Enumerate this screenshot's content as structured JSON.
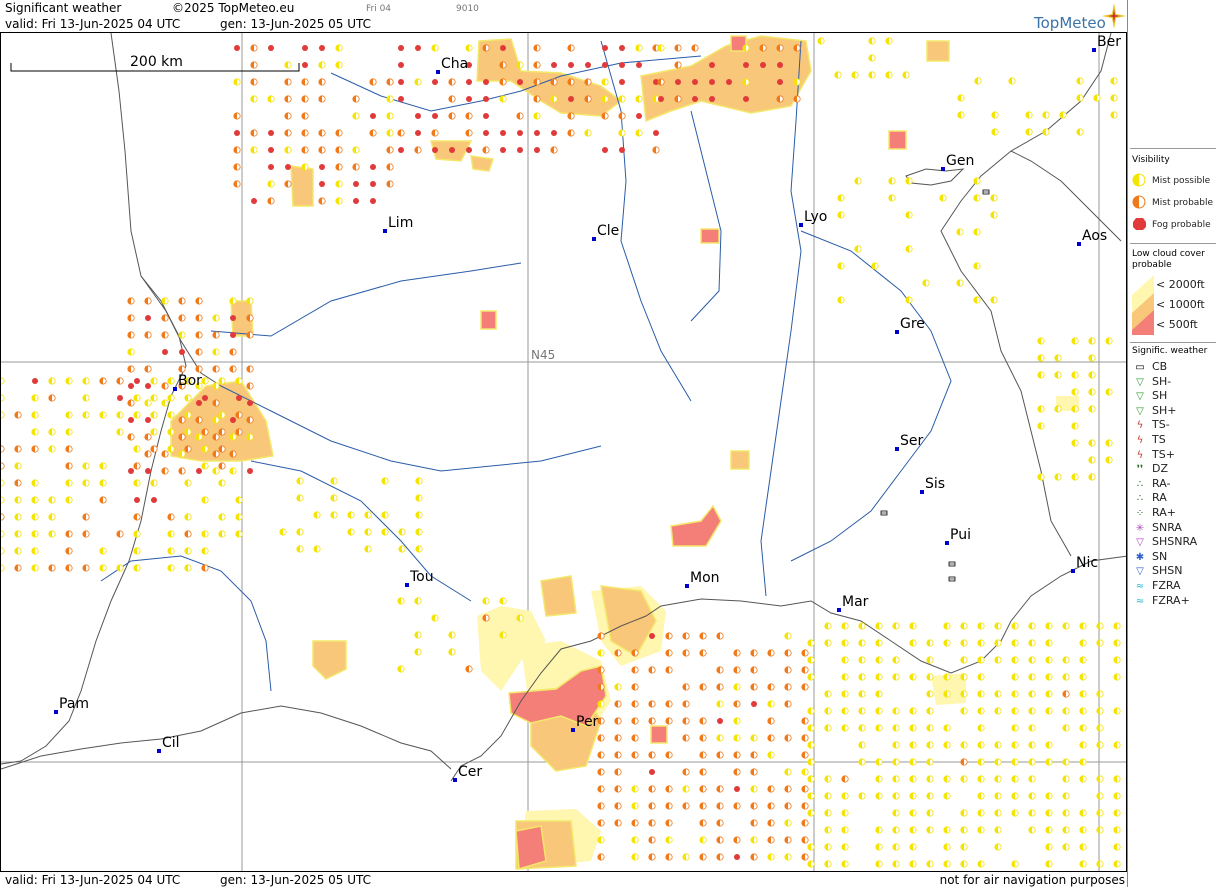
{
  "header": {
    "title": "Significant weather",
    "copyright": "©2025 TopMeteo.eu",
    "valid": "valid:  Fri  13-Jun-2025  04 UTC",
    "gen": "gen: 13-Jun-2025 05 UTC",
    "mini_label": "Fri 04",
    "mini_code": "9010",
    "logo": "TopMeteo"
  },
  "footer": {
    "valid": "valid:  Fri  13-Jun-2025  04 UTC",
    "gen": "gen: 13-Jun-2025 05 UTC",
    "disclaimer": "not for air navigation purposes"
  },
  "map": {
    "scale_label": "200 km",
    "lat_label": "N45",
    "cities": [
      {
        "name": "Cha"
      },
      {
        "name": "Ber"
      },
      {
        "name": "Gen"
      },
      {
        "name": "Lim"
      },
      {
        "name": "Cle"
      },
      {
        "name": "Lyo"
      },
      {
        "name": "Aos"
      },
      {
        "name": "Gre"
      },
      {
        "name": "Bor"
      },
      {
        "name": "Ser"
      },
      {
        "name": "Sis"
      },
      {
        "name": "Pui"
      },
      {
        "name": "Tou"
      },
      {
        "name": "Mon"
      },
      {
        "name": "Nic"
      },
      {
        "name": "Mar"
      },
      {
        "name": "Pam"
      },
      {
        "name": "Per"
      },
      {
        "name": "Cil"
      },
      {
        "name": "Cer"
      }
    ]
  },
  "legend": {
    "visibility_title": "Visibility",
    "visibility": [
      {
        "label": "Mist possible",
        "color": "#f5e300"
      },
      {
        "label": "Mist probable",
        "color": "#f07a1a"
      },
      {
        "label": "Fog probable",
        "color": "#e03a3a"
      }
    ],
    "cloud_title": "Low cloud cover probable",
    "cloud": [
      {
        "label": "< 2000ft",
        "color": "#fff6b0"
      },
      {
        "label": "< 1000ft",
        "color": "#f9c77a"
      },
      {
        "label": "<   500ft",
        "color": "#f47f78"
      }
    ],
    "sigwx_title": "Signific. weather",
    "sigwx": [
      {
        "label": "CB",
        "icon": "cb-icon"
      },
      {
        "label": "SH-",
        "icon": "shower-light-icon"
      },
      {
        "label": "SH",
        "icon": "shower-icon"
      },
      {
        "label": "SH+",
        "icon": "shower-heavy-icon"
      },
      {
        "label": "TS-",
        "icon": "thunderstorm-light-icon"
      },
      {
        "label": "TS",
        "icon": "thunderstorm-icon"
      },
      {
        "label": "TS+",
        "icon": "thunderstorm-heavy-icon"
      },
      {
        "label": "DZ",
        "icon": "drizzle-icon"
      },
      {
        "label": "RA-",
        "icon": "rain-light-icon"
      },
      {
        "label": "RA",
        "icon": "rain-icon"
      },
      {
        "label": "RA+",
        "icon": "rain-heavy-icon"
      },
      {
        "label": "SNRA",
        "icon": "snow-rain-icon"
      },
      {
        "label": "SHSNRA",
        "icon": "snow-rain-shower-icon"
      },
      {
        "label": "SN",
        "icon": "snow-icon"
      },
      {
        "label": "SHSN",
        "icon": "snow-shower-icon"
      },
      {
        "label": "FZRA",
        "icon": "freezing-rain-icon"
      },
      {
        "label": "FZRA+",
        "icon": "freezing-rain-heavy-icon"
      }
    ]
  }
}
